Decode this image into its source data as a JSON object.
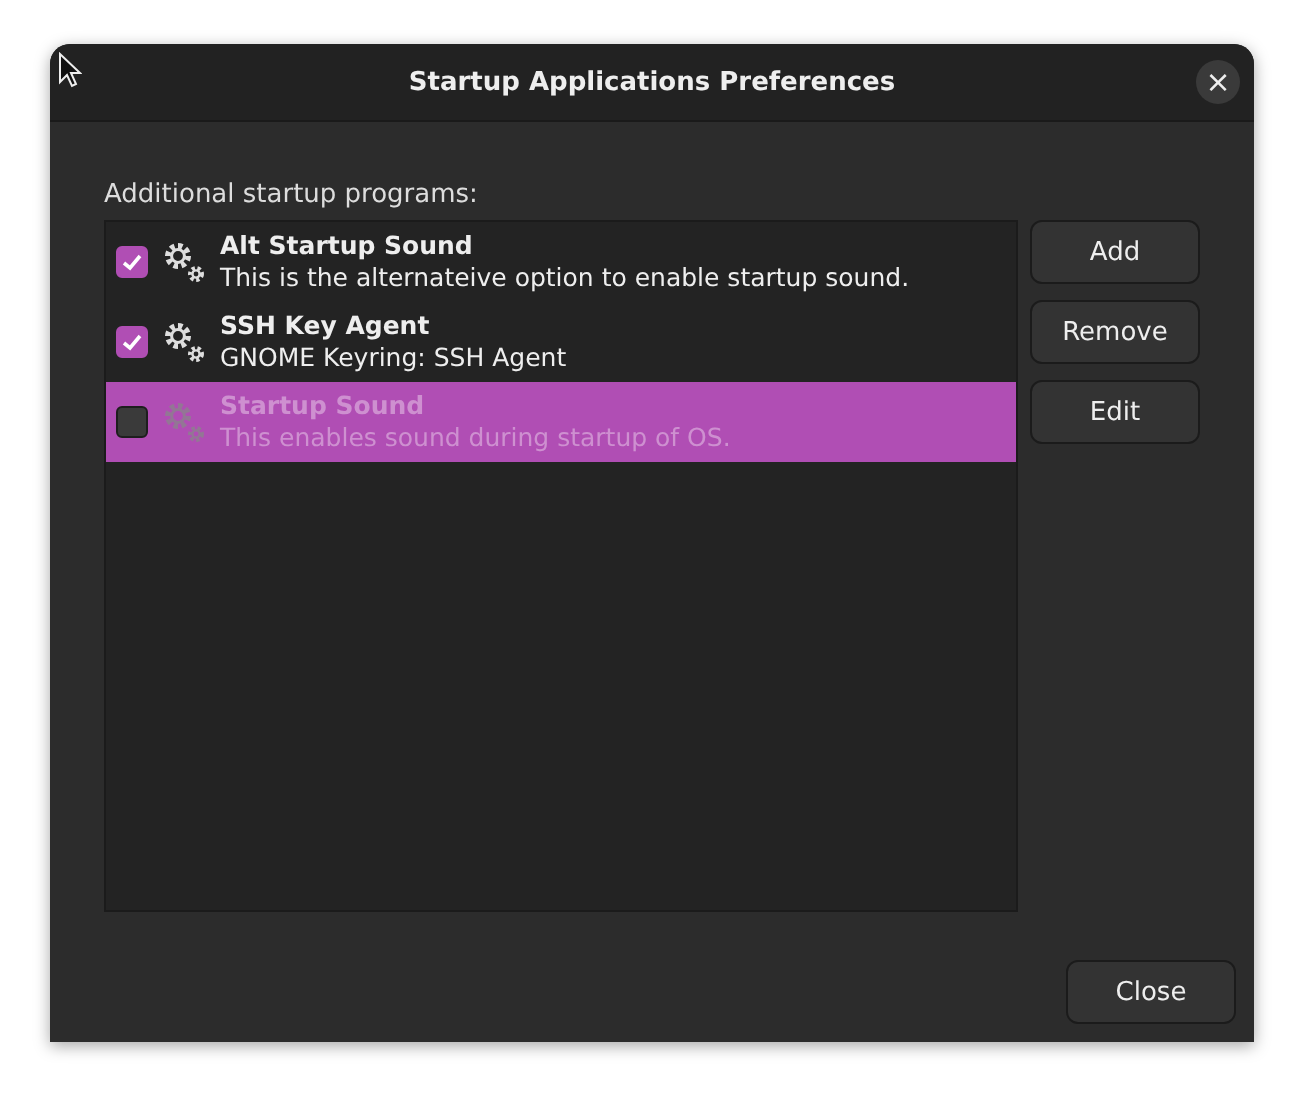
{
  "window": {
    "title": "Startup Applications Preferences",
    "close_glyph": "×"
  },
  "list_label": "Additional startup programs:",
  "programs": [
    {
      "name": "Alt Startup Sound",
      "description": "This is the alternateive option to enable startup sound.",
      "checked": true,
      "selected": false
    },
    {
      "name": "SSH Key Agent",
      "description": "GNOME Keyring: SSH Agent",
      "checked": true,
      "selected": false
    },
    {
      "name": "Startup Sound",
      "description": "This enables sound during startup of OS.",
      "checked": false,
      "selected": true
    }
  ],
  "side_buttons": [
    "Add",
    "Remove",
    "Edit"
  ],
  "footer_buttons": [
    "Close"
  ]
}
